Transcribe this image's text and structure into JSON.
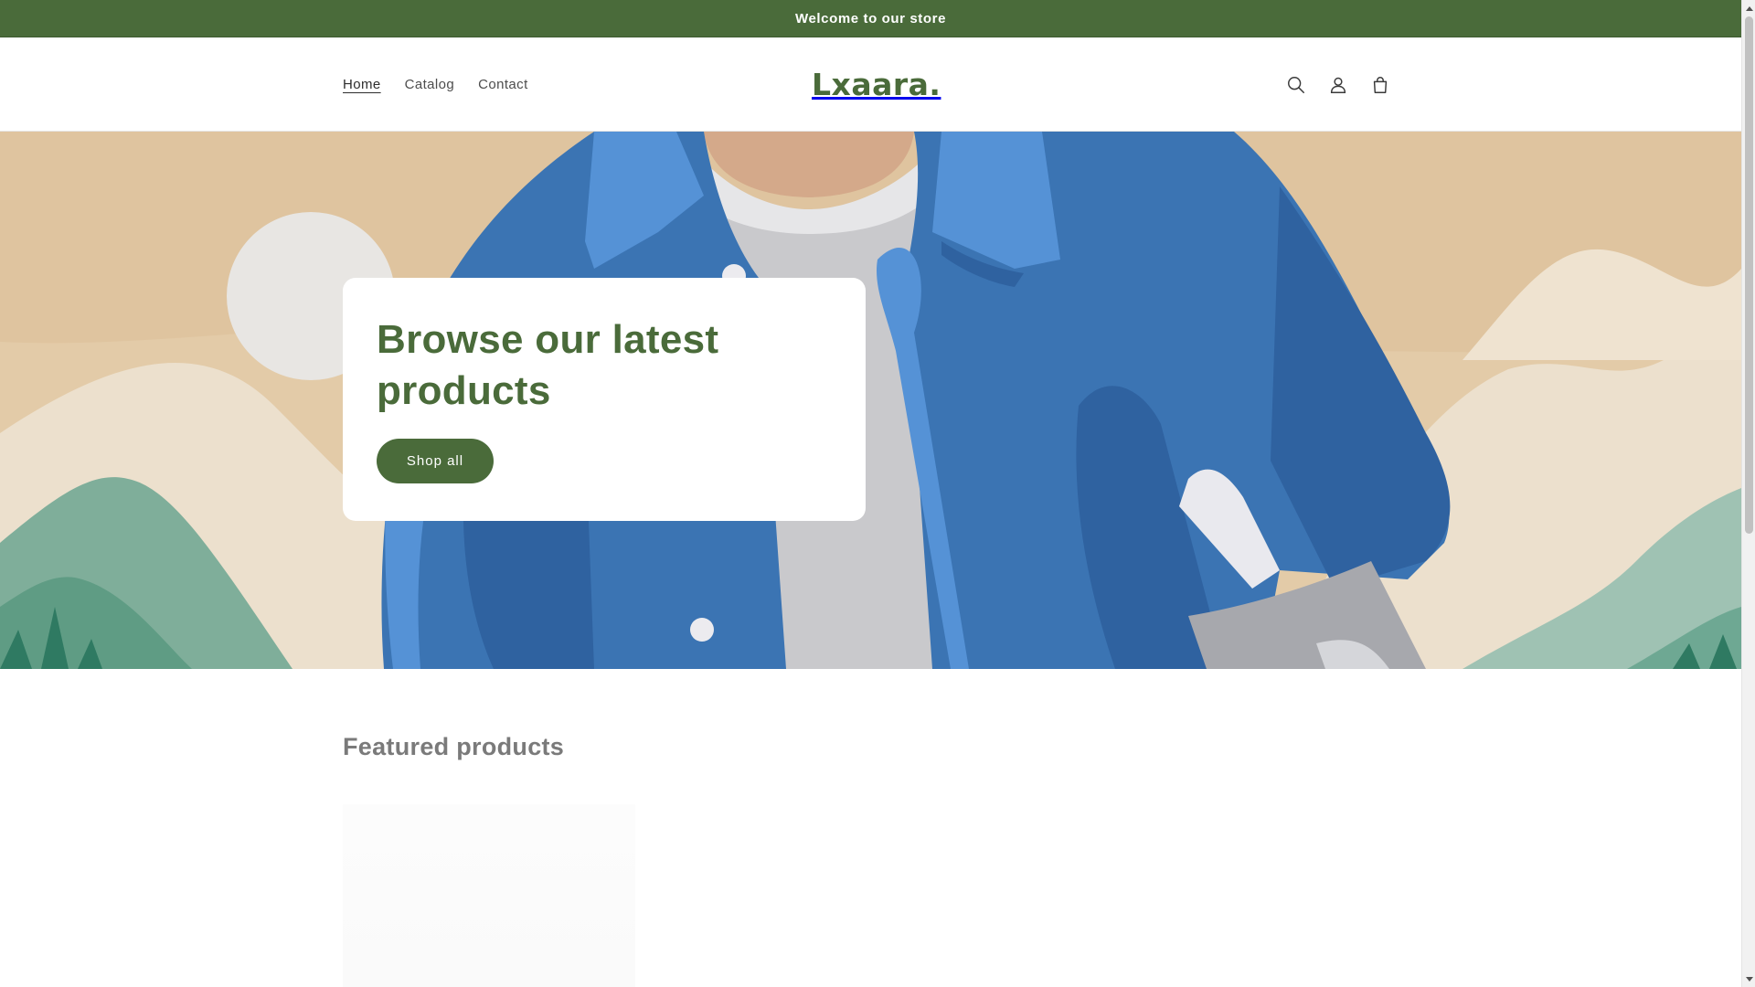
{
  "announcement": {
    "text": "Welcome to our store"
  },
  "nav": {
    "items": [
      {
        "label": "Home",
        "active": true
      },
      {
        "label": "Catalog",
        "active": false
      },
      {
        "label": "Contact",
        "active": false
      }
    ]
  },
  "brand": {
    "logo_text": "Lxaara."
  },
  "header_icons": [
    "search-icon",
    "account-icon",
    "cart-icon"
  ],
  "hero": {
    "title": "Browse our latest products",
    "button_label": "Shop all"
  },
  "featured": {
    "title": "Featured products"
  },
  "colors": {
    "accent": "#4a6b3a",
    "hero_bg": "#e3cba8",
    "jacket_blue": "#3b74b3"
  }
}
